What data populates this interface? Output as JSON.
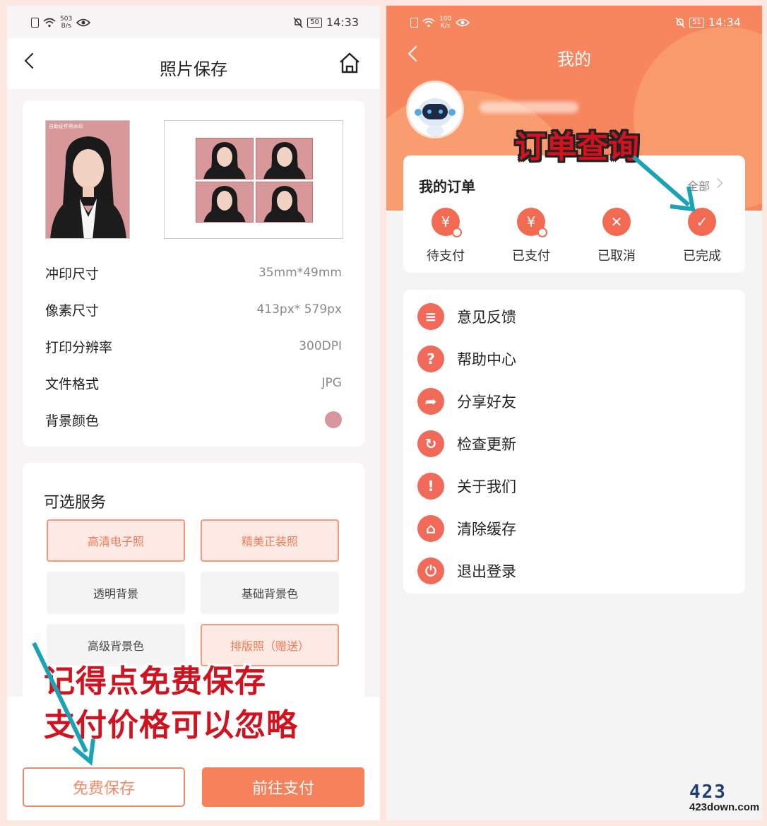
{
  "left": {
    "status": {
      "net_speed": "503",
      "net_unit": "B/s",
      "battery": "50",
      "time": "14:33"
    },
    "nav": {
      "title": "照片保存"
    },
    "id_photo": {
      "watermark": "自助证件照水印"
    },
    "info": [
      {
        "label": "冲印尺寸",
        "value": "35mm*49mm"
      },
      {
        "label": "像素尺寸",
        "value": "413px* 579px"
      },
      {
        "label": "打印分辨率",
        "value": "300DPI"
      },
      {
        "label": "文件格式",
        "value": "JPG"
      },
      {
        "label": "背景颜色",
        "value": ""
      }
    ],
    "background_color": "#d6979c",
    "services": {
      "title": "可选服务",
      "items": [
        {
          "label": "高清电子照",
          "selected": true
        },
        {
          "label": "精美正装照",
          "selected": true
        },
        {
          "label": "透明背景",
          "selected": false
        },
        {
          "label": "基础背景色",
          "selected": false
        },
        {
          "label": "高级背景色",
          "selected": false
        },
        {
          "label": "排版照（赠送）",
          "selected": true
        }
      ]
    },
    "buttons": {
      "free_save": "免费保存",
      "go_pay": "前往支付"
    },
    "annotation": {
      "line1": "记得点免费保存",
      "line2": "支付价格可以忽略"
    }
  },
  "right": {
    "status": {
      "net_speed": "100",
      "net_unit": "K/s",
      "battery": "51",
      "time": "14:34"
    },
    "nav": {
      "title": "我的"
    },
    "orders": {
      "title": "我的订单",
      "all": "全部",
      "items": [
        {
          "label": "待支付",
          "icon": "yen-clock-icon"
        },
        {
          "label": "已支付",
          "icon": "yen-check-icon"
        },
        {
          "label": "已取消",
          "icon": "cross-icon"
        },
        {
          "label": "已完成",
          "icon": "check-icon"
        }
      ]
    },
    "menu": [
      {
        "label": "意见反馈",
        "icon": "feedback-icon"
      },
      {
        "label": "帮助中心",
        "icon": "help-icon"
      },
      {
        "label": "分享好友",
        "icon": "share-icon"
      },
      {
        "label": "检查更新",
        "icon": "refresh-icon"
      },
      {
        "label": "关于我们",
        "icon": "info-icon"
      },
      {
        "label": "清除缓存",
        "icon": "broom-icon"
      },
      {
        "label": "退出登录",
        "icon": "power-icon"
      }
    ],
    "annotation": "订单查询"
  },
  "logo": {
    "big": "423",
    "small": "423down.com"
  },
  "colors": {
    "accent": "#f6825b",
    "annotation_red": "#d0131f",
    "arrow_teal": "#1aa3b5"
  }
}
